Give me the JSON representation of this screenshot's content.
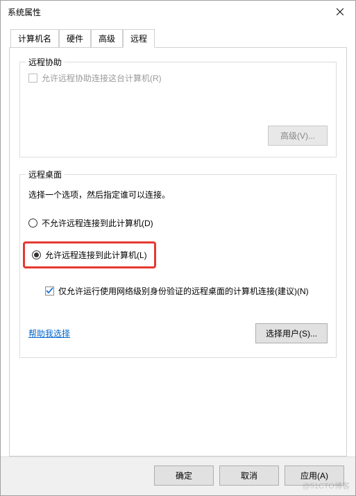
{
  "window": {
    "title": "系统属性"
  },
  "tabs": {
    "computer_name": "计算机名",
    "hardware": "硬件",
    "advanced": "高级",
    "remote": "远程"
  },
  "remote_assist": {
    "group_title": "远程协助",
    "allow_label": "允许远程协助连接这台计算机(R)",
    "advanced_btn": "高级(V)..."
  },
  "remote_desktop": {
    "group_title": "远程桌面",
    "instruction": "选择一个选项，然后指定谁可以连接。",
    "radio_disallow": "不允许远程连接到此计算机(D)",
    "radio_allow": "允许远程连接到此计算机(L)",
    "nla_checkbox": "仅允许运行使用网络级别身份验证的远程桌面的计算机连接(建议)(N)",
    "help_link": "帮助我选择",
    "select_users_btn": "选择用户(S)..."
  },
  "footer": {
    "ok": "确定",
    "cancel": "取消",
    "apply": "应用(A)"
  },
  "watermark": "@51CTO博客"
}
